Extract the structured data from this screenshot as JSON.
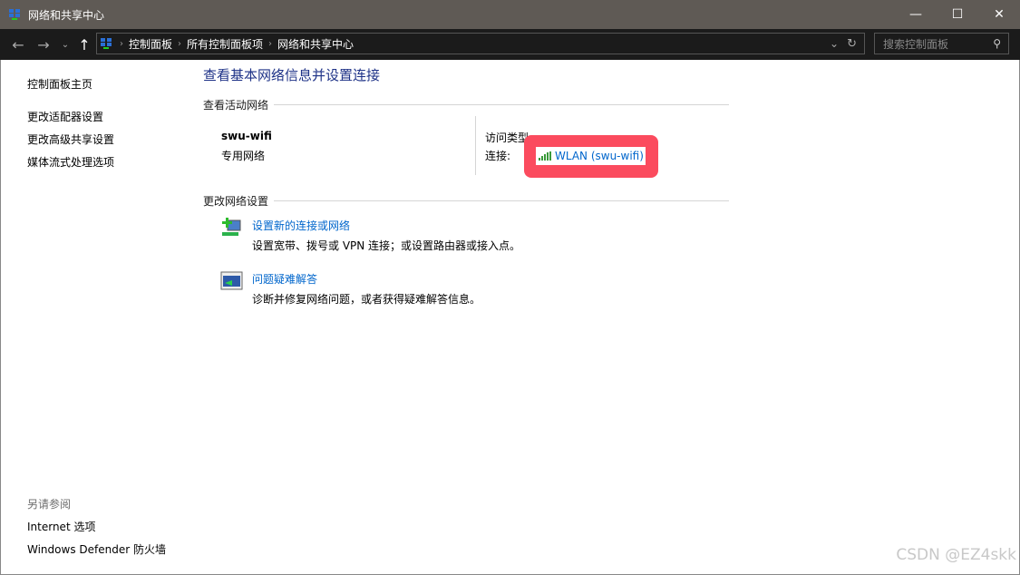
{
  "window": {
    "title": "网络和共享中心",
    "minimize": "—",
    "maximize": "☐",
    "close": "✕"
  },
  "nav": {
    "breadcrumb": [
      "控制面板",
      "所有控制面板项",
      "网络和共享中心"
    ],
    "search_placeholder": "搜索控制面板"
  },
  "sidebar": {
    "items": [
      "控制面板主页",
      "更改适配器设置",
      "更改高级共享设置",
      "媒体流式处理选项"
    ],
    "see_also_title": "另请参阅",
    "see_also": [
      "Internet 选项",
      "Windows Defender 防火墙"
    ]
  },
  "main": {
    "title": "查看基本网络信息并设置连接",
    "active_section": "查看活动网络",
    "network_name": "swu-wifi",
    "network_type": "专用网络",
    "access_type_label": "访问类型:",
    "connection_label": "连接:",
    "connection_value": "WLAN (swu-wifi)",
    "change_section": "更改网络设置",
    "tasks": [
      {
        "title": "设置新的连接或网络",
        "desc": "设置宽带、拨号或 VPN 连接；或设置路由器或接入点。",
        "icon": "new-connection-icon"
      },
      {
        "title": "问题疑难解答",
        "desc": "诊断并修复网络问题，或者获得疑难解答信息。",
        "icon": "troubleshoot-icon"
      }
    ]
  },
  "highlight_color": "#fb4b5e",
  "watermark": "CSDN @EZ4skk"
}
